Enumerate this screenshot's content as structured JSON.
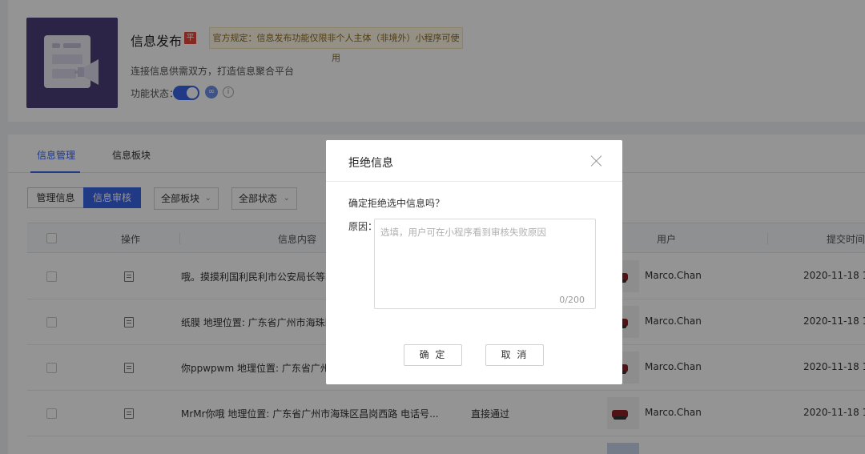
{
  "plugin": {
    "title": "信息发布",
    "tag": "平",
    "notice": "官方规定：信息发布功能仅限非个人主体（非境外）小程序可使用",
    "description": "连接信息供需双方，打造信息聚合平台",
    "status_label": "功能状态：",
    "enabled": true
  },
  "tabs": [
    {
      "label": "信息管理",
      "active": true
    },
    {
      "label": "信息板块",
      "active": false
    }
  ],
  "filters": {
    "segments": [
      {
        "label": "管理信息",
        "active": false
      },
      {
        "label": "信息审核",
        "active": true
      }
    ],
    "board_select": "全部板块",
    "status_select": "全部状态"
  },
  "table": {
    "columns": [
      "操作",
      "信息内容",
      "用户",
      "提交时间"
    ],
    "rows": [
      {
        "content": "哦。摸摸利国利民利市公安局长等车哦。",
        "state": "",
        "user": "Marco.Chan",
        "time": "2020-11-18 18:"
      },
      {
        "content": "纸膜 地理位置: 广东省广州市海珠区昶",
        "state": "",
        "user": "Marco.Chan",
        "time": "2020-11-18 15:"
      },
      {
        "content": "你ppwpwm 地理位置: 广东省广州市海",
        "state": "",
        "user": "Marco.Chan",
        "time": "2020-11-18 15:"
      },
      {
        "content": "MrMr你哦 地理位置: 广东省广州市海珠区昌岗西路 电话号...",
        "state": "直接通过",
        "user": "Marco.Chan",
        "time": "2020-11-18 15:"
      }
    ]
  },
  "modal": {
    "title": "拒绝信息",
    "question": "确定拒绝选中信息吗？",
    "reason_label": "原因：",
    "reason_placeholder": "选填，用户可在小程序看到审核失败原因",
    "reason_count": "0/200",
    "confirm_label": "确 定",
    "cancel_label": "取 消"
  },
  "colors": {
    "accent": "#3a64e6",
    "tag": "#e4493d",
    "cover": "#4b3f79"
  }
}
